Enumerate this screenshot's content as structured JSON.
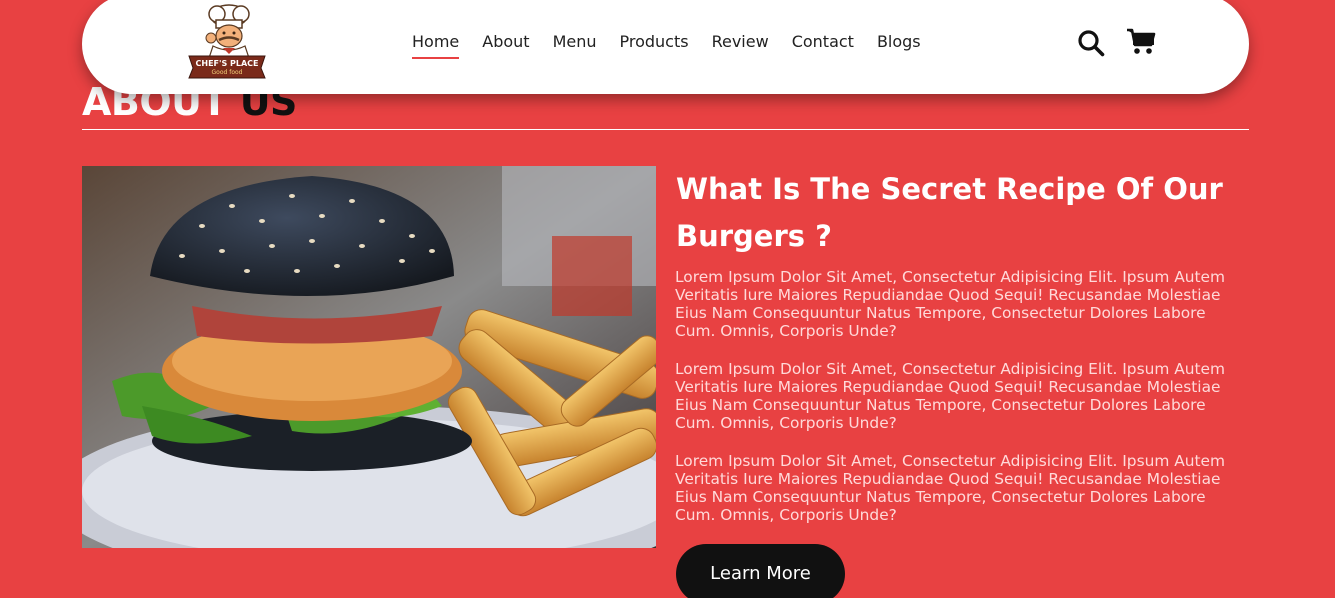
{
  "header": {
    "logo": {
      "name": "chef-logo",
      "line1": "CHEF'S PLACE",
      "line2": "Good food"
    },
    "nav": [
      {
        "label": "Home",
        "active": true
      },
      {
        "label": "About",
        "active": false
      },
      {
        "label": "Menu",
        "active": false
      },
      {
        "label": "Products",
        "active": false
      },
      {
        "label": "Review",
        "active": false
      },
      {
        "label": "Contact",
        "active": false
      },
      {
        "label": "Blogs",
        "active": false
      }
    ],
    "icons": [
      "search-icon",
      "cart-icon"
    ]
  },
  "section": {
    "title_part1": "ABOUT",
    "title_part2": "US"
  },
  "about": {
    "image": "burger-with-fries-photo",
    "heading": "What Is The Secret Recipe Of Our Burgers ?",
    "paragraphs": [
      "Lorem Ipsum Dolor Sit Amet, Consectetur Adipisicing Elit. Ipsum Autem Veritatis Iure Maiores Repudiandae Quod Sequi! Recusandae Molestiae Eius Nam Consequuntur Natus Tempore, Consectetur Dolores Labore Cum. Omnis, Corporis Unde?",
      "Lorem Ipsum Dolor Sit Amet, Consectetur Adipisicing Elit. Ipsum Autem Veritatis Iure Maiores Repudiandae Quod Sequi! Recusandae Molestiae Eius Nam Consequuntur Natus Tempore, Consectetur Dolores Labore Cum. Omnis, Corporis Unde?",
      "Lorem Ipsum Dolor Sit Amet, Consectetur Adipisicing Elit. Ipsum Autem Veritatis Iure Maiores Repudiandae Quod Sequi! Recusandae Molestiae Eius Nam Consequuntur Natus Tempore, Consectetur Dolores Labore Cum. Omnis, Corporis Unde?"
    ],
    "button_label": "Learn More"
  },
  "colors": {
    "background": "#e84142",
    "header": "#ffffff",
    "button": "#111111",
    "active_underline": "#e84142"
  }
}
